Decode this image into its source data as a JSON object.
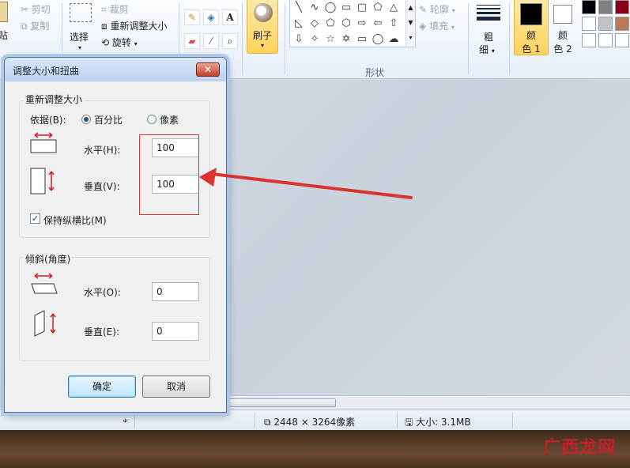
{
  "ribbon": {
    "paste_label": "贴",
    "cut_label": "剪切",
    "copy_label": "复制",
    "select_label": "选择",
    "crop_label": "裁剪",
    "resize_label": "重新调整大小",
    "rotate_label": "旋转",
    "tools_text_glyph": "A",
    "brush_label": "刷子",
    "shapes_group_label": "形状",
    "outline_label": "轮廓",
    "fill_label": "填充",
    "size_label_1": "粗",
    "size_label_2": "细",
    "color1_label_1": "颜",
    "color1_label_2": "色 1",
    "color2_label_1": "颜",
    "color2_label_2": "色 2",
    "color1_value": "#000000",
    "color2_value": "#ffffff",
    "palette": [
      "#000000",
      "#7f7f7f",
      "#880015",
      "#ffffff",
      "#c3c3c3",
      "#b97a57",
      "#ffffff",
      "#ffffff",
      "#ffffff"
    ]
  },
  "dialog": {
    "title": "调整大小和扭曲",
    "close_glyph": "✕",
    "resize_group": {
      "title": "重新调整大小",
      "basis_label": "依据(B):",
      "percent_label": "百分比",
      "pixels_label": "像素",
      "selected_basis": "percent",
      "horizontal_label": "水平(H):",
      "horizontal_value": "100",
      "vertical_label": "垂直(V):",
      "vertical_value": "100",
      "keep_ratio_label": "保持纵横比(M)",
      "keep_ratio_checked": true
    },
    "skew_group": {
      "title": "倾斜(角度)",
      "horizontal_label": "水平(O):",
      "horizontal_value": "0",
      "vertical_label": "垂直(E):",
      "vertical_value": "0"
    },
    "ok_label": "确定",
    "cancel_label": "取消"
  },
  "status": {
    "dimensions": "2448 × 3264像素",
    "size": "大小: 3.1MB"
  },
  "watermark": {
    "text": "广西龙网"
  },
  "accent_red": "#d9342f"
}
